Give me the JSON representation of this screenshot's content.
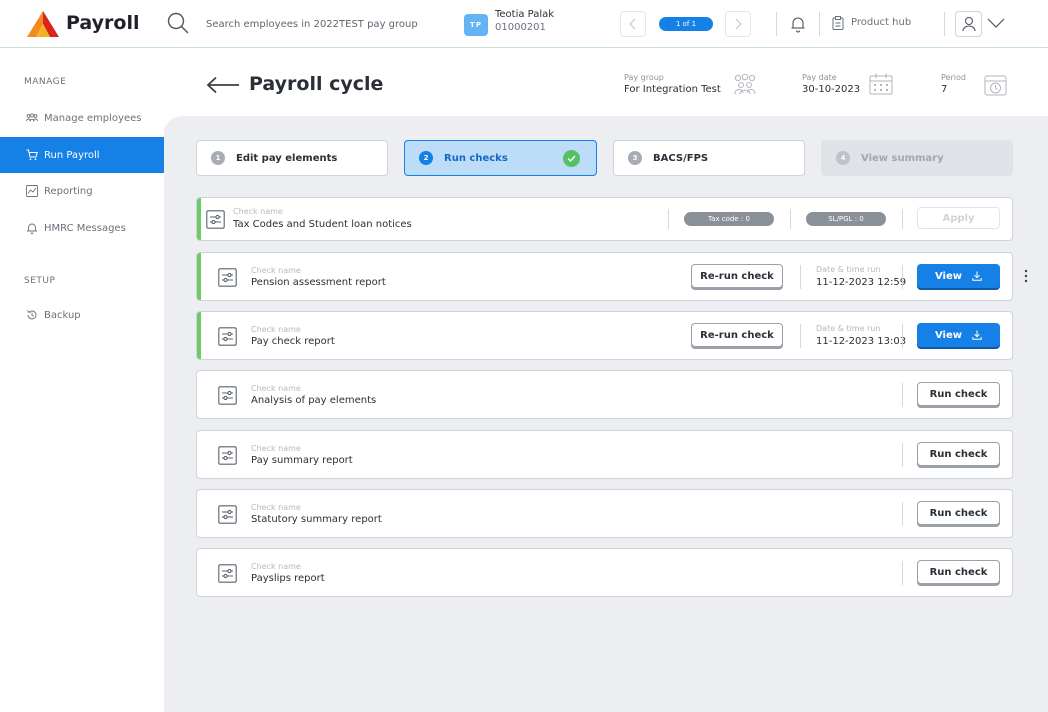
{
  "app": {
    "brand": "Payroll"
  },
  "header": {
    "search_placeholder": "Search employees in 2022TEST pay group",
    "employee": {
      "initials": "TP",
      "name": "Teotia Palak",
      "id": "01000201"
    },
    "pager": {
      "count": "1 of 1"
    },
    "product_hub": "Product hub"
  },
  "sidebar": {
    "manage_label": "MANAGE",
    "setup_label": "SETUP",
    "items": [
      {
        "label": "Manage employees",
        "icon": "people-icon"
      },
      {
        "label": "Run Payroll",
        "icon": "cart-icon",
        "active": true
      },
      {
        "label": "Reporting",
        "icon": "chart-icon"
      },
      {
        "label": "HMRC Messages",
        "icon": "bell-icon"
      },
      {
        "label": "Backup",
        "icon": "restore-icon"
      }
    ]
  },
  "page": {
    "title": "Payroll cycle",
    "pay_group_label": "Pay group",
    "pay_group_value": "For Integration Test",
    "pay_date_label": "Pay date",
    "pay_date_value": "30-10-2023",
    "period_label": "Period",
    "period_value": "7"
  },
  "steps": [
    {
      "num": "1",
      "label": "Edit pay elements",
      "state": "normal"
    },
    {
      "num": "2",
      "label": "Run checks",
      "state": "active"
    },
    {
      "num": "3",
      "label": "BACS/FPS",
      "state": "normal"
    },
    {
      "num": "4",
      "label": "View summary",
      "state": "disabled"
    }
  ],
  "checks": {
    "check_name_label": "Check name",
    "datetime_label": "Date & time run",
    "rerun_label": "Re-run check",
    "view_label": "View",
    "run_label": "Run check",
    "apply_label": "Apply",
    "tax_codes": {
      "name": "Tax Codes and Student loan notices",
      "tax_code_pill": "Tax code : 0",
      "sl_pill": "SL/PGL : 0"
    },
    "items": [
      {
        "name": "Pension assessment report",
        "datetime": "11-12-2023 12:59"
      },
      {
        "name": "Pay check report",
        "datetime": "11-12-2023 13:03"
      },
      {
        "name": "Analysis of pay elements"
      },
      {
        "name": "Pay summary report"
      },
      {
        "name": "Statutory summary report"
      },
      {
        "name": "Payslips report"
      }
    ]
  },
  "colors": {
    "accent": "#1580e6",
    "success": "#55c065",
    "done_bar": "#6ccb66"
  }
}
